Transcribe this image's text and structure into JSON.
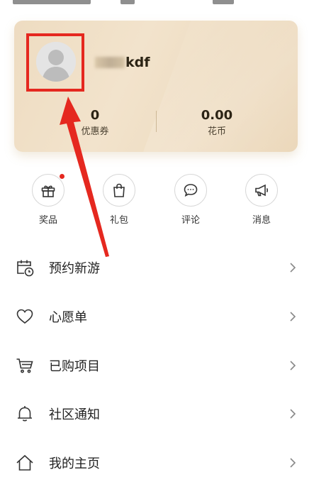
{
  "profile": {
    "username_suffix": "kdf",
    "coupons": {
      "value": "0",
      "label": "优惠券"
    },
    "coins": {
      "value": "0.00",
      "label": "花币"
    }
  },
  "quick_actions": [
    {
      "label": "奖品",
      "icon": "gift-icon",
      "has_badge": true
    },
    {
      "label": "礼包",
      "icon": "bag-icon",
      "has_badge": false
    },
    {
      "label": "评论",
      "icon": "comment-icon",
      "has_badge": false
    },
    {
      "label": "消息",
      "icon": "megaphone-icon",
      "has_badge": false
    }
  ],
  "menu": [
    {
      "label": "预约新游",
      "icon": "calendar-clock-icon"
    },
    {
      "label": "心愿单",
      "icon": "heart-icon"
    },
    {
      "label": "已购项目",
      "icon": "cart-icon"
    },
    {
      "label": "社区通知",
      "icon": "bell-icon"
    },
    {
      "label": "我的主页",
      "icon": "home-icon"
    }
  ],
  "colors": {
    "accent_red": "#e5281f",
    "card_gold": "#eedcc1",
    "text_dark": "#222222"
  }
}
